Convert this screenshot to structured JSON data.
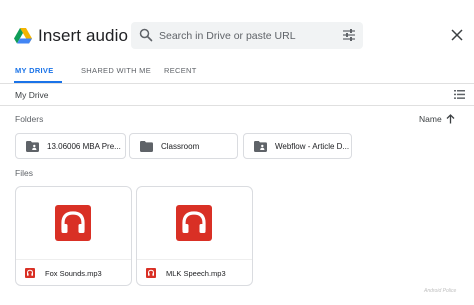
{
  "header": {
    "title": "Insert audio",
    "search_placeholder": "Search in Drive or paste URL"
  },
  "tabs": [
    {
      "label": "MY DRIVE",
      "active": true
    },
    {
      "label": "SHARED WITH ME",
      "active": false
    },
    {
      "label": "RECENT",
      "active": false
    }
  ],
  "breadcrumb": "My Drive",
  "folders_section": {
    "label": "Folders",
    "sort_label": "Name",
    "items": [
      {
        "name": "13.06006 MBA Pre...",
        "icon": "shared-folder-icon"
      },
      {
        "name": "Classroom",
        "icon": "folder-icon"
      },
      {
        "name": "Webflow - Article D...",
        "icon": "shared-folder-icon"
      }
    ]
  },
  "files_section": {
    "label": "Files",
    "items": [
      {
        "name": "Fox Sounds.mp3",
        "icon": "audio-file-icon"
      },
      {
        "name": "MLK Speech.mp3",
        "icon": "audio-file-icon"
      }
    ]
  },
  "watermark": "Android Police",
  "colors": {
    "accent": "#1a73e8",
    "audio_red": "#d93025",
    "drive_green": "#0f9d58",
    "drive_yellow": "#f4b400",
    "drive_blue": "#4285f4"
  }
}
